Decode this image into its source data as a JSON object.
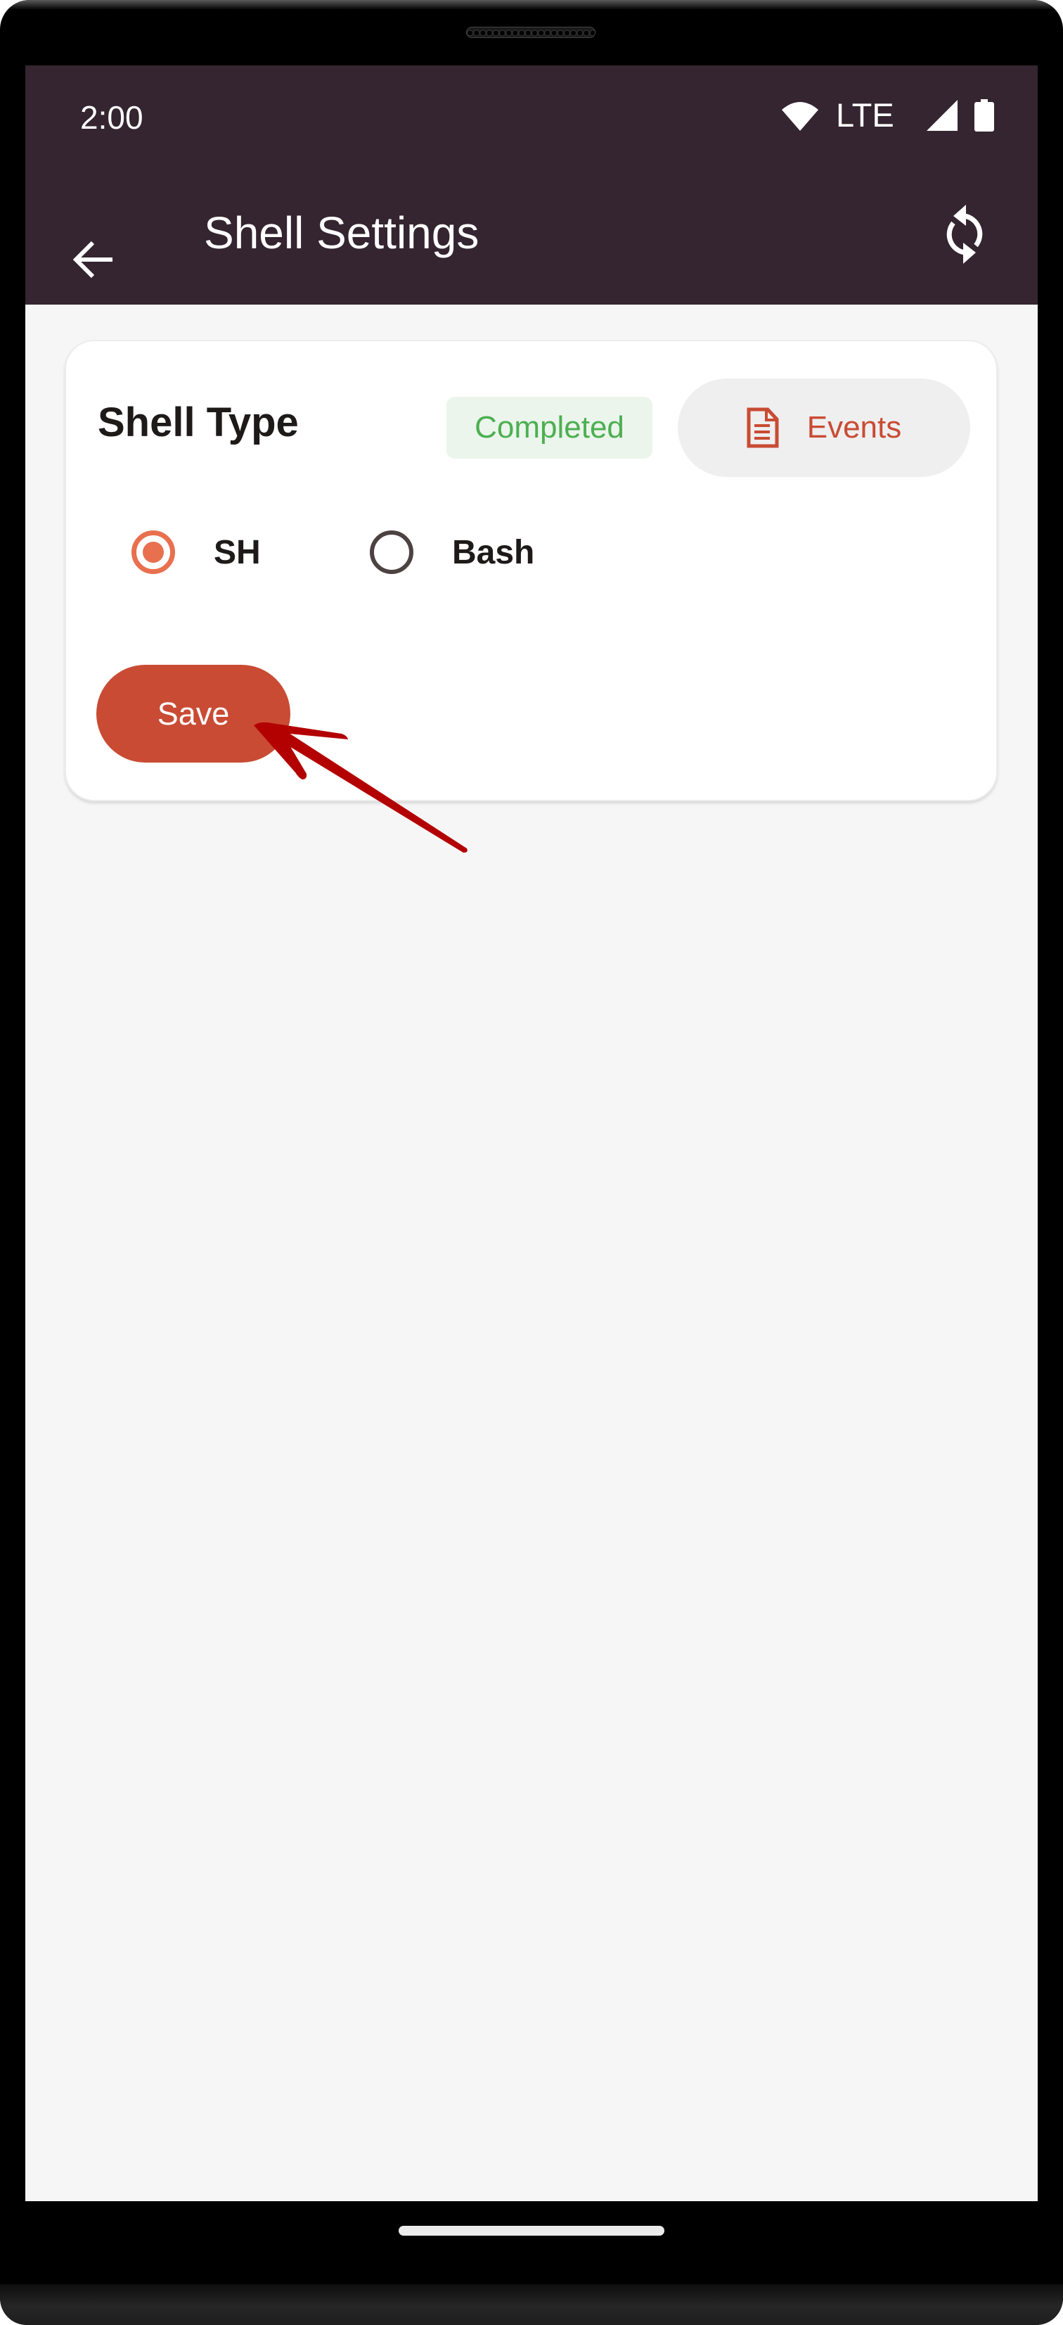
{
  "status_bar": {
    "time": "2:00",
    "network": "LTE",
    "icons": [
      "wifi-icon",
      "signal-icon",
      "battery-icon"
    ]
  },
  "app_bar": {
    "title": "Shell Settings",
    "back_icon": "arrow-left-icon",
    "refresh_icon": "sync-icon"
  },
  "card": {
    "title": "Shell Type",
    "status_badge": "Completed",
    "events_button": {
      "label": "Events",
      "icon": "document-icon"
    },
    "options": [
      {
        "label": "SH",
        "selected": true
      },
      {
        "label": "Bash",
        "selected": false
      }
    ],
    "save_button": "Save"
  },
  "colors": {
    "app_bar_bg": "#342530",
    "accent": "#c94b34",
    "radio_selected": "#e8704f",
    "badge_text": "#4caf50",
    "badge_bg": "#ebf5ec",
    "annotation_arrow": "#b30000"
  }
}
